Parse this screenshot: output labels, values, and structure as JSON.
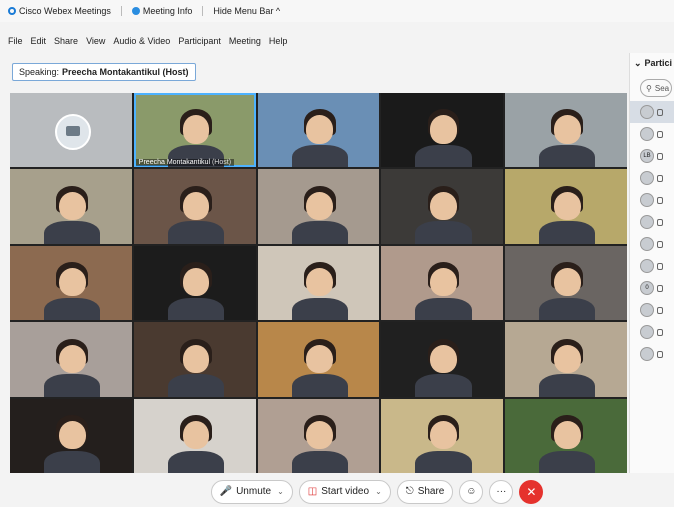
{
  "titlebar": {
    "app_name": "Cisco Webex Meetings",
    "meeting_info": "Meeting Info",
    "hide_menu": "Hide Menu Bar ^"
  },
  "menu": [
    "File",
    "Edit",
    "Share",
    "View",
    "Audio & Video",
    "Participant",
    "Meeting",
    "Help"
  ],
  "speaking": {
    "prefix": "Speaking:",
    "name": "Preecha Montakantikul (Host)"
  },
  "tiles": [
    {
      "bg": "#b9bcbf",
      "type": "avatar"
    },
    {
      "bg": "#8a9a6a",
      "type": "video",
      "name": "Preecha Montakantikul",
      "host": "(Host)",
      "active": true
    },
    {
      "bg": "#6a8fb5",
      "type": "video"
    },
    {
      "bg": "#1a1a1a",
      "type": "video"
    },
    {
      "bg": "#9aa2a6",
      "type": "video"
    },
    {
      "bg": "#a7a08c",
      "type": "video"
    },
    {
      "bg": "#6b5548",
      "type": "video"
    },
    {
      "bg": "#a59a8f",
      "type": "video"
    },
    {
      "bg": "#3c3a38",
      "type": "video"
    },
    {
      "bg": "#b7a86a",
      "type": "video"
    },
    {
      "bg": "#8c6a50",
      "type": "video"
    },
    {
      "bg": "#1c1c1c",
      "type": "video"
    },
    {
      "bg": "#cfc6b9",
      "type": "video"
    },
    {
      "bg": "#b09a8c",
      "type": "video"
    },
    {
      "bg": "#6a6562",
      "type": "video"
    },
    {
      "bg": "#a89f9a",
      "type": "video"
    },
    {
      "bg": "#4a3a30",
      "type": "video"
    },
    {
      "bg": "#b8874a",
      "type": "video"
    },
    {
      "bg": "#202020",
      "type": "video"
    },
    {
      "bg": "#b6a893",
      "type": "video"
    },
    {
      "bg": "#241f1d",
      "type": "video"
    },
    {
      "bg": "#d6d2cc",
      "type": "video"
    },
    {
      "bg": "#b09f93",
      "type": "video"
    },
    {
      "bg": "#c9b88a",
      "type": "video"
    },
    {
      "bg": "#4a6a3a",
      "type": "video"
    }
  ],
  "participants_panel": {
    "title": "Partici",
    "search_placeholder": "Sea",
    "rows": [
      "",
      "",
      "LB",
      "",
      "",
      "",
      "",
      "",
      "0",
      "",
      "",
      ""
    ]
  },
  "controls": {
    "unmute": "Unmute",
    "start_video": "Start video",
    "share": "Share",
    "more": "···",
    "end": "✕"
  }
}
